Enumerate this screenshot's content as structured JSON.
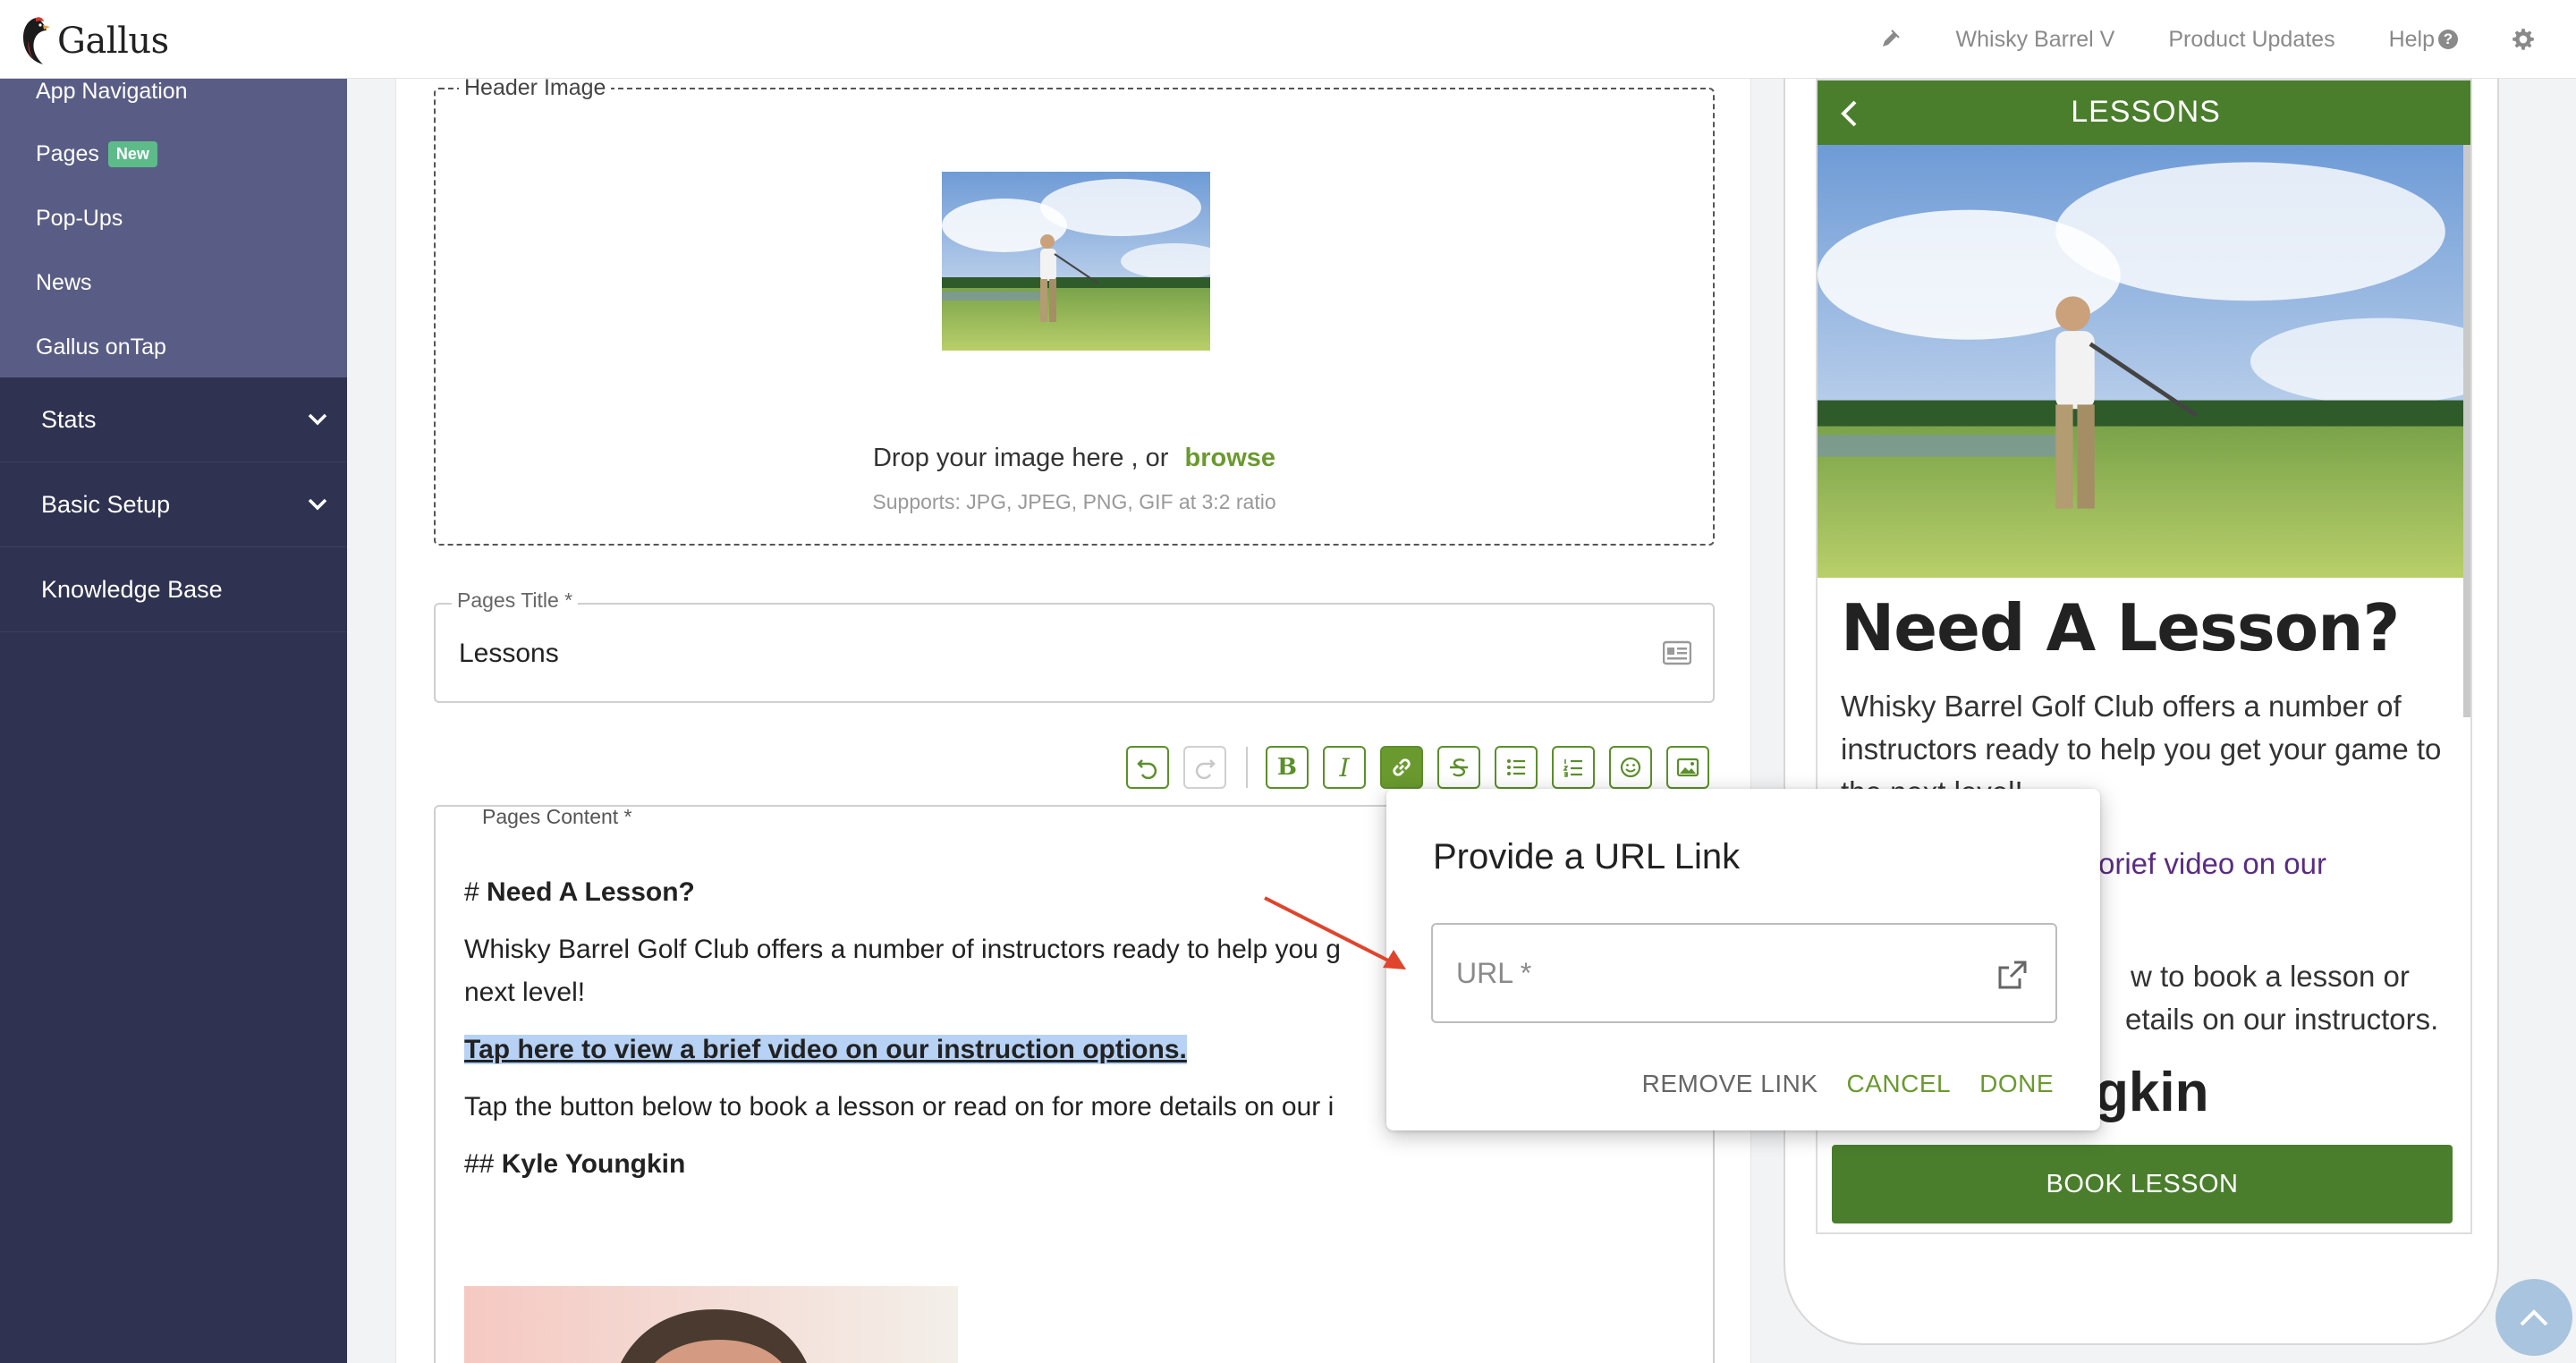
{
  "brand": {
    "name": "Gallus"
  },
  "topnav": {
    "site": "Whisky Barrel V",
    "updates": "Product Updates",
    "help": "Help",
    "help_mark": "?"
  },
  "sidebar": {
    "subitems": [
      {
        "label": "App Navigation"
      },
      {
        "label": "Pages",
        "badge": "New"
      },
      {
        "label": "Pop-Ups"
      },
      {
        "label": "News"
      },
      {
        "label": "Gallus onTap"
      }
    ],
    "sections": [
      {
        "label": "Stats",
        "expandable": true
      },
      {
        "label": "Basic Setup",
        "expandable": true
      },
      {
        "label": "Knowledge Base",
        "expandable": false
      }
    ]
  },
  "editor": {
    "header_image": {
      "legend": "Header Image",
      "drop_text": "Drop your image here , or",
      "browse": "browse",
      "supports": "Supports: JPG, JPEG, PNG, GIF at 3:2 ratio"
    },
    "title_field": {
      "legend": "Pages Title *",
      "value": "Lessons"
    },
    "content_field": {
      "legend": "Pages Content *",
      "h1_marker": "#",
      "h1": "Need A Lesson?",
      "p1": "Whisky Barrel Golf Club offers a number of instructors ready to help you g",
      "p1_cont": "next level!",
      "link_text": "Tap here to view a brief video on our instruction options.",
      "p2": "Tap the button below to book a lesson or read on for more details on our i",
      "h2_marker": "##",
      "h2": "Kyle Youngkin"
    },
    "toolbar": {
      "bold": "B",
      "italic": "I"
    }
  },
  "preview": {
    "header_title": "LESSONS",
    "h1": "Need A Lesson?",
    "p1": "Whisky Barrel Golf Club offers a number of instructors ready to help you get your game to the next level!",
    "link_tail": "orief video on our",
    "p2_line1": "w to book a lesson or",
    "p2_line2": "etails on our instructors.",
    "h2_tail": "gkin",
    "button": "BOOK LESSON"
  },
  "dialog": {
    "title": "Provide a URL Link",
    "url_placeholder": "URL *",
    "remove": "REMOVE LINK",
    "cancel": "CANCEL",
    "done": "DONE"
  },
  "colors": {
    "accent_green": "#6a9a2f",
    "preview_green": "#4a7e2d",
    "sidebar_dark": "#2f3250",
    "sidebar_sub": "#595d86",
    "link_purple": "#5a2b82",
    "selection_blue": "#b7d2f5",
    "arrow_red": "#e0442c"
  }
}
